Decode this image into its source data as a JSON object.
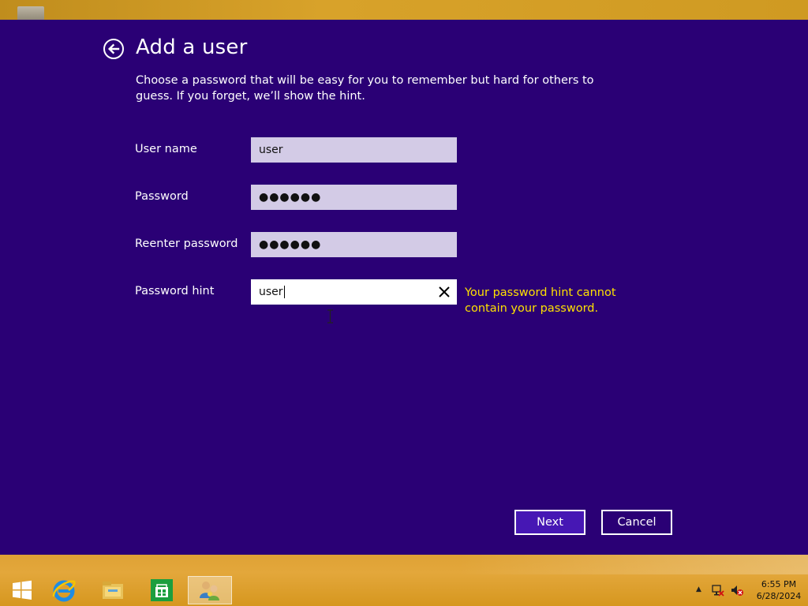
{
  "window": {
    "title": "Add a user",
    "description": "Choose a password that will be easy for you to remember but hard for others to guess. If you forget, we’ll show the hint.",
    "background_color": "#2a0075"
  },
  "form": {
    "username": {
      "label": "User name",
      "value": "user"
    },
    "password": {
      "label": "Password",
      "masked_value": "●●●●●●"
    },
    "reenter_password": {
      "label": "Reenter password",
      "masked_value": "●●●●●●"
    },
    "password_hint": {
      "label": "Password hint",
      "value": "user"
    },
    "error": "Your password hint cannot contain your password.",
    "error_color": "#ffe100"
  },
  "buttons": {
    "next": "Next",
    "cancel": "Cancel"
  },
  "taskbar": {
    "items": [
      "start-icon",
      "internet-explorer-icon",
      "file-explorer-icon",
      "store-icon",
      "user-accounts-icon"
    ],
    "clock": {
      "time": "6:55 PM",
      "date": "6/28/2024"
    }
  }
}
